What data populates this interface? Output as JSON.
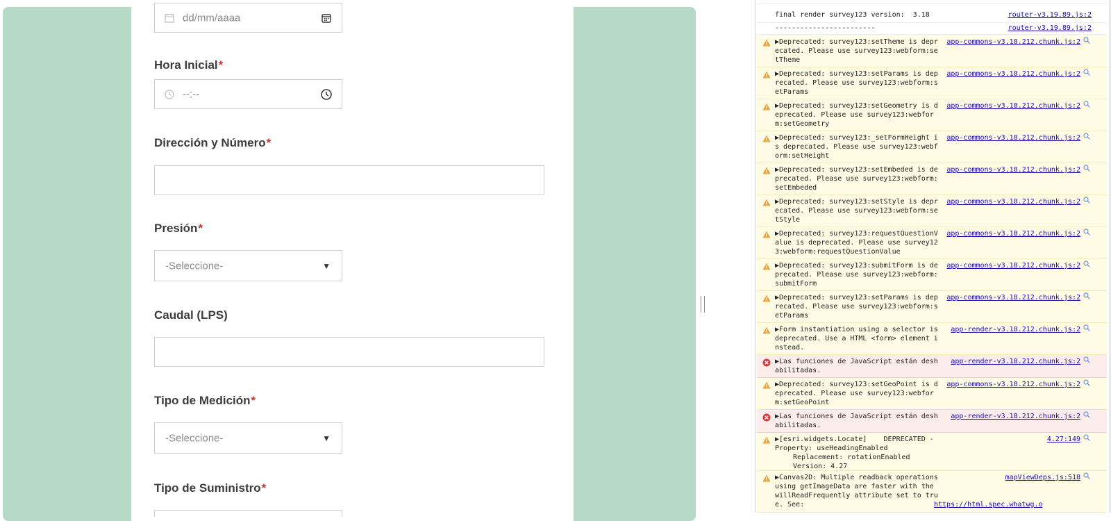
{
  "form": {
    "date": {
      "placeholder": "dd/mm/aaaa"
    },
    "hora_inicial": {
      "label": "Hora Inicial",
      "required": "*",
      "placeholder": "--:--"
    },
    "direccion": {
      "label": "Dirección y Número",
      "required": "*",
      "value": ""
    },
    "presion": {
      "label": "Presión",
      "required": "*",
      "selected": "-Seleccione-"
    },
    "caudal": {
      "label": "Caudal (LPS)",
      "value": ""
    },
    "tipo_medicion": {
      "label": "Tipo de Medición",
      "required": "*",
      "selected": "-Seleccione-"
    },
    "tipo_suministro": {
      "label": "Tipo de Suministro",
      "required": "*"
    }
  },
  "colors": {
    "frame_green": "#b7dac7",
    "required_red": "#c0392b",
    "warn_bg": "#fffbe5",
    "error_bg": "#fdecec",
    "link_blue": "#1a0dab"
  },
  "console": {
    "messages": [
      {
        "level": "log",
        "text": "final render survey123 version:  3.18",
        "source": "router-v3.19.89.js:2"
      },
      {
        "level": "log",
        "text": "------------------------",
        "source": "router-v3.19.89.js:2"
      },
      {
        "level": "warning",
        "text": "▶Deprecated: survey123:setTheme is deprecated. Please use survey123:webform:setTheme",
        "source": "app-commons-v3.18.212.chunk.js:2"
      },
      {
        "level": "warning",
        "text": "▶Deprecated: survey123:setParams is deprecated. Please use survey123:webform:setParams",
        "source": "app-commons-v3.18.212.chunk.js:2"
      },
      {
        "level": "warning",
        "text": "▶Deprecated: survey123:setGeometry is deprecated. Please use survey123:webform:setGeometry",
        "source": "app-commons-v3.18.212.chunk.js:2"
      },
      {
        "level": "warning",
        "text": "▶Deprecated: survey123:_setFormHeight is deprecated. Please use survey123:webform:setHeight",
        "source": "app-commons-v3.18.212.chunk.js:2"
      },
      {
        "level": "warning",
        "text": "▶Deprecated: survey123:setEmbeded is deprecated. Please use survey123:webform:setEmbeded",
        "source": "app-commons-v3.18.212.chunk.js:2"
      },
      {
        "level": "warning",
        "text": "▶Deprecated: survey123:setStyle is deprecated. Please use survey123:webform:setStyle",
        "source": "app-commons-v3.18.212.chunk.js:2"
      },
      {
        "level": "warning",
        "text": "▶Deprecated: survey123:requestQuestionValue is deprecated. Please use survey123:webform:requestQuestionValue",
        "source": "app-commons-v3.18.212.chunk.js:2"
      },
      {
        "level": "warning",
        "text": "▶Deprecated: survey123:submitForm is deprecated. Please use survey123:webform:submitForm",
        "source": "app-commons-v3.18.212.chunk.js:2"
      },
      {
        "level": "warning",
        "text": "▶Deprecated: survey123:setParams is deprecated. Please use survey123:webform:setParams",
        "source": "app-commons-v3.18.212.chunk.js:2"
      },
      {
        "level": "warning",
        "text": "▶Form instantiation using a selector is deprecated. Use a HTML <form> element instead.",
        "source": "app-render-v3.18.212.chunk.js:2"
      },
      {
        "level": "error",
        "text": "▶Las funciones de JavaScript están deshabilitadas.",
        "source": "app-render-v3.18.212.chunk.js:2"
      },
      {
        "level": "warning",
        "text": "▶Deprecated: survey123:setGeoPoint is deprecated. Please use survey123:webform:setGeoPoint",
        "source": "app-commons-v3.18.212.chunk.js:2"
      },
      {
        "level": "error",
        "text": "▶Las funciones de JavaScript están deshabilitadas.",
        "source": "app-render-v3.18.212.chunk.js:2"
      },
      {
        "level": "warning",
        "text": "▶[esri.widgets.Locate]    DEPRECATED - Property: useHeadingEnabled",
        "source": "4.27:149",
        "replacement": "Replacement: rotationEnabled",
        "version": "Version: 4.27"
      },
      {
        "level": "warning",
        "text": "▶Canvas2D: Multiple readback operations using getImageData are faster with the willReadFrequently attribute set to true. See:",
        "source": "mapViewDeps.js:518",
        "link": "https://html.spec.whatwg.o"
      }
    ]
  }
}
